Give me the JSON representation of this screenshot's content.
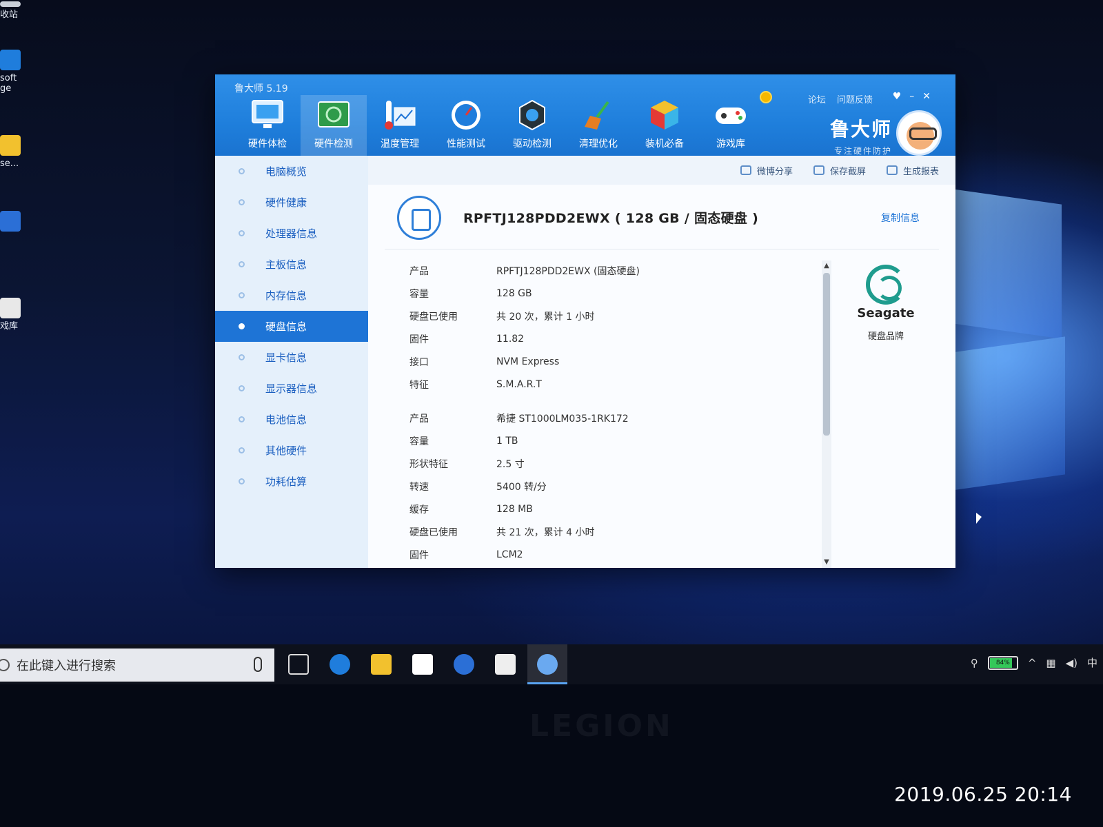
{
  "desktop": {
    "icons": [
      {
        "label": "收站",
        "color": "#c9ced8"
      },
      {
        "label": "soft\nge",
        "color": "#1f7ddc"
      },
      {
        "label": "se...",
        "color": "#f2c12e"
      },
      {
        "label": "",
        "color": "#2b6fd6"
      },
      {
        "label": "戏库",
        "color": "#e8e8e8"
      }
    ]
  },
  "app": {
    "title": "鲁大师 5.19",
    "title_links": [
      "论坛",
      "问题反馈"
    ],
    "window_controls": [
      "♥",
      "–",
      "✕"
    ],
    "tabs": [
      {
        "label": "硬件体检",
        "icon": "monitor-icon"
      },
      {
        "label": "硬件检测",
        "icon": "hardware-board-icon",
        "active": true
      },
      {
        "label": "温度管理",
        "icon": "thermometer-icon"
      },
      {
        "label": "性能测试",
        "icon": "speedometer-icon"
      },
      {
        "label": "驱动检测",
        "icon": "gear-icon"
      },
      {
        "label": "清理优化",
        "icon": "broom-icon"
      },
      {
        "label": "装机必备",
        "icon": "cube-icon"
      },
      {
        "label": "游戏库",
        "icon": "gamepad-icon"
      }
    ],
    "brand_name": "鲁大师",
    "brand_slogan": "专注硬件防护",
    "sidebar": [
      {
        "label": "电脑概览"
      },
      {
        "label": "硬件健康"
      },
      {
        "label": "处理器信息"
      },
      {
        "label": "主板信息"
      },
      {
        "label": "内存信息"
      },
      {
        "label": "硬盘信息",
        "active": true
      },
      {
        "label": "显卡信息"
      },
      {
        "label": "显示器信息"
      },
      {
        "label": "电池信息"
      },
      {
        "label": "其他硬件"
      },
      {
        "label": "功耗估算"
      }
    ],
    "toolbar": {
      "share": "微博分享",
      "screenshot": "保存截屏",
      "report": "生成报表"
    },
    "disk_title": "RPFTJ128PDD2EWX ( 128 GB / 固态硬盘 )",
    "copy_info": "复制信息",
    "disk1": [
      {
        "k": "产品",
        "v": "RPFTJ128PDD2EWX (固态硬盘)"
      },
      {
        "k": "容量",
        "v": "128 GB"
      },
      {
        "k": "硬盘已使用",
        "v": "共 20 次，累计 1 小时"
      },
      {
        "k": "固件",
        "v": "11.82"
      },
      {
        "k": "接口",
        "v": "NVM Express"
      },
      {
        "k": "特征",
        "v": "S.M.A.R.T"
      }
    ],
    "disk2": [
      {
        "k": "产品",
        "v": "希捷 ST1000LM035-1RK172"
      },
      {
        "k": "容量",
        "v": "1 TB"
      },
      {
        "k": "形状特征",
        "v": "2.5 寸"
      },
      {
        "k": "转速",
        "v": "5400 转/分"
      },
      {
        "k": "缓存",
        "v": "128 MB"
      },
      {
        "k": "硬盘已使用",
        "v": "共 21 次，累计 4 小时"
      },
      {
        "k": "固件",
        "v": "LCM2"
      }
    ],
    "brand_logo_name": "Seagate",
    "brand_caption": "硬盘品牌"
  },
  "taskbar": {
    "search_placeholder": "在此键入进行搜索",
    "battery": "84%",
    "ime": "中"
  },
  "bezel_logo": "LEGION",
  "photo_timestamp": "2019.06.25 20:14"
}
